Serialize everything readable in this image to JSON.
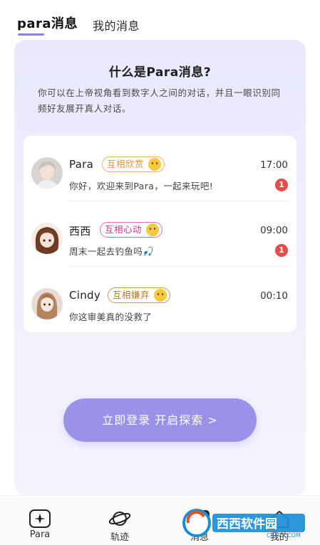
{
  "tabs": [
    {
      "label": "para消息",
      "active": true
    },
    {
      "label": "我的消息",
      "active": false
    }
  ],
  "intro": {
    "title": "什么是Para消息?",
    "description": "你可以在上帝视角看到数字人之间的对话，并且一眼识别同频好友展开真人对话。"
  },
  "conversations": [
    {
      "name": "Para",
      "tag": "互相欣赏",
      "tag_color": "#e8932a",
      "time": "17:00",
      "message": "你好，欢迎来到Para，一起来玩吧!",
      "unread": "1"
    },
    {
      "name": "西西",
      "tag": "互相心动",
      "tag_color": "#d6359a",
      "time": "09:00",
      "message": "周末一起去钓鱼吗🎣",
      "unread": "1"
    },
    {
      "name": "Cindy",
      "tag": "互相嫌弃",
      "tag_color": "#b07a2a",
      "time": "00:10",
      "message": "你这审美真的没救了",
      "unread": ""
    }
  ],
  "login_button": {
    "label": "立即登录 开启探索 >"
  },
  "bottom_nav": [
    {
      "label": "Para",
      "icon": "sparkle-icon"
    },
    {
      "label": "轨迹",
      "icon": "planet-icon"
    },
    {
      "label": "消息",
      "icon": "message-icon"
    },
    {
      "label": "我的",
      "icon": "home-icon"
    }
  ],
  "watermark": {
    "brand": "西西软件园",
    "domain": "CR173.COM"
  },
  "colors": {
    "accent": "#8c7ef0",
    "button": "#9b91e8",
    "unread": "#e84a4a"
  }
}
